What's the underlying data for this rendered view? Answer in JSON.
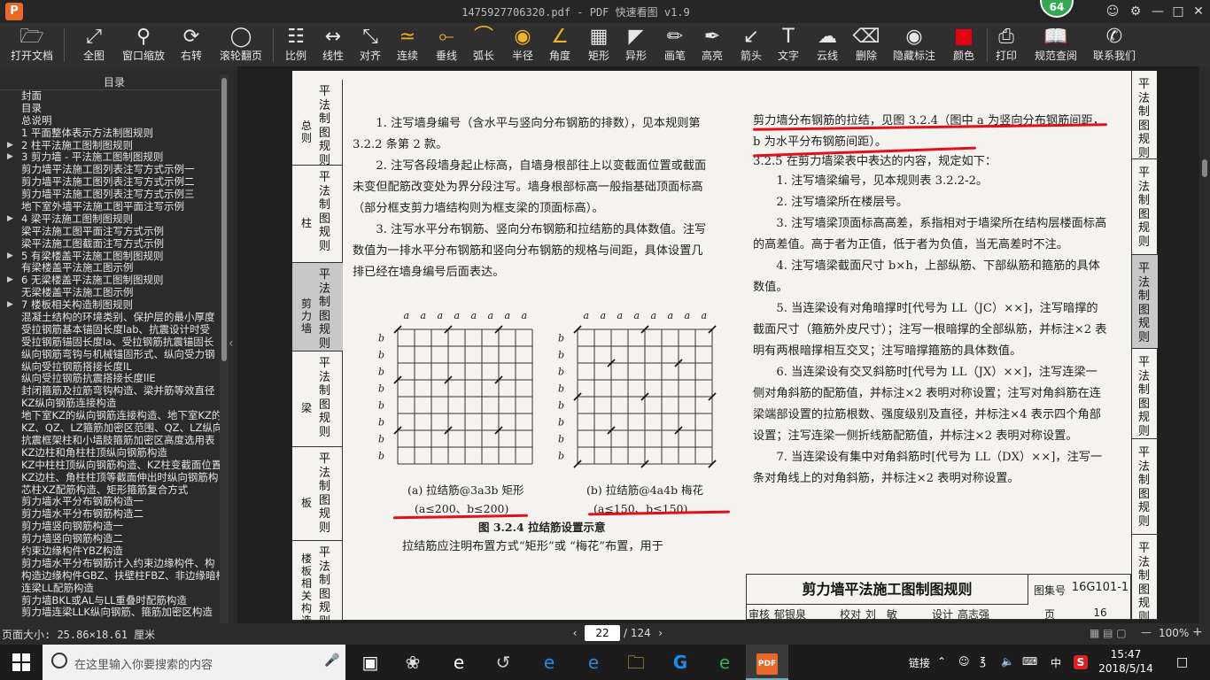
{
  "window": {
    "title": "1475927706320.pdf - PDF 快速看图 v1.9",
    "badge": "64"
  },
  "toolbar": {
    "items": [
      "打开文档",
      "全图",
      "窗口缩放",
      "右转",
      "滚轮翻页",
      "比例",
      "线性",
      "对齐",
      "连续",
      "垂线",
      "弧长",
      "半径",
      "角度",
      "矩形",
      "异形",
      "画笔",
      "高亮",
      "箭头",
      "文字",
      "云线",
      "删除",
      "隐藏标注",
      "颜色",
      "打印",
      "规范查阅",
      "联系我们"
    ]
  },
  "sidebar": {
    "title": "目录",
    "items": [
      {
        "label": "封面",
        "arrow": false
      },
      {
        "label": "目录",
        "arrow": false
      },
      {
        "label": "总说明",
        "arrow": false
      },
      {
        "label": "1 平面整体表示方法制图规则",
        "arrow": false
      },
      {
        "label": "2 柱平法施工图制图规则",
        "arrow": true
      },
      {
        "label": "3 剪力墙 - 平法施工图制图规则",
        "arrow": true
      },
      {
        "label": "剪力墙平法施工图列表注写方式示例一",
        "arrow": false
      },
      {
        "label": "剪力墙平法施工图列表注写方式示例二",
        "arrow": false
      },
      {
        "label": "剪力墙平法施工图列表注写方式示例三",
        "arrow": false
      },
      {
        "label": "地下室外墙平法施工图平面注写示例",
        "arrow": false
      },
      {
        "label": "4 梁平法施工图制图规则",
        "arrow": true
      },
      {
        "label": "梁平法施工图平面注写方式示例",
        "arrow": false
      },
      {
        "label": "梁平法施工图截面注写方式示例",
        "arrow": false
      },
      {
        "label": "5 有梁楼盖平法施工图制图规则",
        "arrow": true
      },
      {
        "label": "有梁楼盖平法施工图示例",
        "arrow": false
      },
      {
        "label": "6 无梁楼盖平法施工图制图规则",
        "arrow": true
      },
      {
        "label": "无梁楼盖平法施工图示例",
        "arrow": false
      },
      {
        "label": "7 楼板相关构造制图规则",
        "arrow": true
      },
      {
        "label": "混凝土结构的环境类别、保护层的最小厚度",
        "arrow": false
      },
      {
        "label": "受拉钢筋基本锚固长度lab、抗震设计时受",
        "arrow": false
      },
      {
        "label": "受拉钢筋锚固长度la、受拉钢筋抗震锚固长",
        "arrow": false
      },
      {
        "label": "纵向钢筋弯钩与机械锚固形式、纵向受力钢",
        "arrow": false
      },
      {
        "label": "纵向受拉钢筋搭接长度lL",
        "arrow": false
      },
      {
        "label": "纵向受拉钢筋抗震搭接长度llE",
        "arrow": false
      },
      {
        "label": "封闭箍筋及拉筋弯钩构造、梁并筋等效直径",
        "arrow": false
      },
      {
        "label": "KZ纵向钢筋连接构造",
        "arrow": false
      },
      {
        "label": "地下室KZ的纵向钢筋连接构造、地下室KZ的",
        "arrow": false
      },
      {
        "label": "KZ、QZ、LZ箍筋加密区范围、QZ、LZ纵向钢",
        "arrow": false
      },
      {
        "label": "抗震框架柱和小墙肢箍筋加密区高度选用表",
        "arrow": false
      },
      {
        "label": "KZ边柱和角柱柱顶纵向钢筋构造",
        "arrow": false
      },
      {
        "label": "KZ中柱柱顶纵向钢筋构造、KZ柱变截面位置",
        "arrow": false
      },
      {
        "label": "KZ边柱、角柱柱顶等截面伸出时纵向钢筋构",
        "arrow": false
      },
      {
        "label": "芯柱XZ配筋构造、矩形箍筋复合方式",
        "arrow": false
      },
      {
        "label": "剪力墙水平分布钢筋构造一",
        "arrow": false
      },
      {
        "label": "剪力墙水平分布钢筋构造二",
        "arrow": false
      },
      {
        "label": "剪力墙竖向钢筋构造一",
        "arrow": false
      },
      {
        "label": "剪力墙竖向钢筋构造二",
        "arrow": false
      },
      {
        "label": "约束边缘构件YBZ构造",
        "arrow": false
      },
      {
        "label": "剪力墙水平分布钢筋计入约束边缘构件、构",
        "arrow": false
      },
      {
        "label": "构造边缘构件GBZ、扶壁柱FBZ、非边缘暗柱",
        "arrow": false
      },
      {
        "label": "连梁LL配筋构造",
        "arrow": false
      },
      {
        "label": "剪力墙BKL或AL与LL重叠时配筋构造",
        "arrow": false
      },
      {
        "label": "剪力墙连梁LLK纵向钢筋、箍筋加密区构造",
        "arrow": false
      }
    ]
  },
  "page": {
    "left_tabs": [
      {
        "big": "平法制图规则",
        "small": "总则",
        "active": false
      },
      {
        "big": "平法制图规则",
        "small": "柱",
        "active": false
      },
      {
        "big": "平法制图规则",
        "small": "剪力墙",
        "active": true
      },
      {
        "big": "平法制图规则",
        "small": "梁",
        "active": false
      },
      {
        "big": "平法制图规则",
        "small": "板",
        "active": false
      },
      {
        "big": "平法制图规则",
        "small": "楼板相关构造",
        "active": false
      }
    ],
    "right_tabs": [
      {
        "big": "平法制图规则",
        "active": false
      },
      {
        "big": "平法制图规则",
        "active": false
      },
      {
        "big": "平法制图规则",
        "active": true
      },
      {
        "big": "平法制图规则",
        "active": false
      },
      {
        "big": "平法制图规则",
        "active": false
      },
      {
        "big": "平法制图规则",
        "active": false
      }
    ],
    "left_col": {
      "p1": "1. 注写墙身编号（含水平与竖向分布钢筋的排数），见本规则第 3.2.2 条第 2 款。",
      "p2": "2. 注写各段墙身起止标高，自墙身根部往上以变截面位置或截面未变但配筋改变处为界分段注写。墙身根部标高一般指基础顶面标高（部分框支剪力墙结构则为框支梁的顶面标高）。",
      "p3": "3. 注写水平分布钢筋、竖向分布钢筋和拉结筋的具体数值。注写数值为一排水平分布钢筋和竖向分布钢筋的规格与间距，具体设置几排已经在墙身编号后面表达。"
    },
    "figure": {
      "label_a": "a",
      "label_b": "b",
      "cap_a_line1": "(a) 拉结筋@3a3b 矩形",
      "cap_a_line2": "(a≤200、b≤200)",
      "cap_b_line1": "(b) 拉结筋@4a4b 梅花",
      "cap_b_line2": "(a≤150、b≤150)",
      "title": "图 3.2.4 拉结筋设置示意",
      "after": "拉结筋应注明布置方式“矩形”或 “梅花”布置，用于"
    },
    "right_col": {
      "p0": "剪力墙分布钢筋的拉结，见图 3.2.4（图中 a 为竖向分布钢筋间距， b 为水平分布钢筋间距）。",
      "h": "3.2.5 在剪力墙梁表中表达的内容，规定如下：",
      "p1": "1. 注写墙梁编号，见本规则表 3.2.2-2。",
      "p2": "2. 注写墙梁所在楼层号。",
      "p3": "3. 注写墙梁顶面标高高差，系指相对于墙梁所在结构层楼面标高的高差值。高于者为正值，低于者为负值，当无高差时不注。",
      "p4": "4. 注写墙梁截面尺寸 b×h，上部纵筋、下部纵筋和箍筋的具体数值。",
      "p5": "5. 当连梁设有对角暗撑时[代号为 LL（JC）××]，注写暗撑的截面尺寸（箍筋外皮尺寸）；注写一根暗撑的全部纵筋，并标注×2 表明有两根暗撑相互交叉；注写暗撑箍筋的具体数值。",
      "p6": "6. 当连梁设有交叉斜筋时[代号为 LL（JX）××]，注写连梁一侧对角斜筋的配筋值，并标注×2 表明对称设置；注写对角斜筋在连梁端部设置的拉筋根数、强度级别及直径，并标注×4 表示四个角部设置；注写连梁一侧折线筋配筋值，并标注×2 表明对称设置。",
      "p7": "7. 当连梁设有集中对角斜筋时[代号为 LL（DX）××]，注写一条对角线上的对角斜筋，并标注×2 表明对称设置。"
    },
    "title_block": {
      "name": "剪力墙平法施工图制图规则",
      "atlas_label": "图集号",
      "atlas": "16G101-1",
      "row2": [
        "审核",
        "郁银泉",
        "校对",
        "刘　敏",
        "设计",
        "高志强"
      ],
      "page_label": "页",
      "page_no": "16"
    }
  },
  "status": {
    "page_size": "页面大小: 25.86×18.61 厘米",
    "current_page": "22",
    "total_pages": "/ 124",
    "zoom": "100%"
  },
  "taskbar": {
    "search_placeholder": "在这里输入你要搜索的内容",
    "link": "链接",
    "ime": "中",
    "time": "15:47",
    "date": "2018/5/14"
  }
}
